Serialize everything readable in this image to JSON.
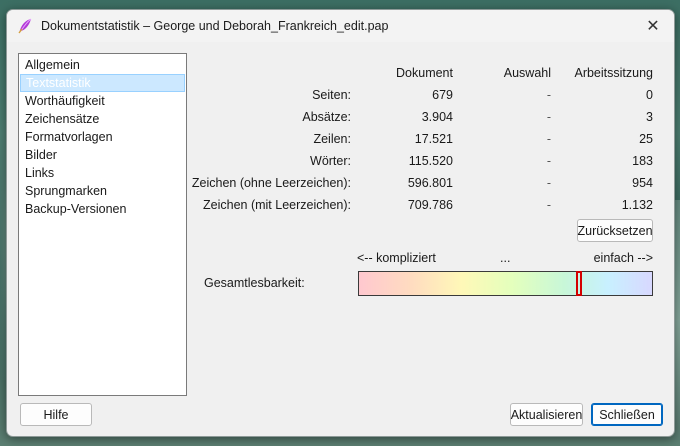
{
  "window": {
    "title": "Dokumentstatistik – George und Deborah_Frankreich_edit.pap",
    "close_glyph": "✕"
  },
  "sidebar": {
    "items": [
      {
        "label": "Allgemein"
      },
      {
        "label": "Textstatistik"
      },
      {
        "label": "Worthäufigkeit"
      },
      {
        "label": "Zeichensätze"
      },
      {
        "label": "Formatvorlagen"
      },
      {
        "label": "Bilder"
      },
      {
        "label": "Links"
      },
      {
        "label": "Sprungmarken"
      },
      {
        "label": "Backup-Versionen"
      }
    ],
    "selected_index": 1
  },
  "stats": {
    "headers": {
      "document": "Dokument",
      "selection": "Auswahl",
      "session": "Arbeitssitzung"
    },
    "rows": [
      {
        "label": "Seiten:",
        "document": "679",
        "selection": "-",
        "session": "0"
      },
      {
        "label": "Absätze:",
        "document": "3.904",
        "selection": "-",
        "session": "3"
      },
      {
        "label": "Zeilen:",
        "document": "17.521",
        "selection": "-",
        "session": "25"
      },
      {
        "label": "Wörter:",
        "document": "115.520",
        "selection": "-",
        "session": "183"
      },
      {
        "label": "Zeichen (ohne Leerzeichen):",
        "document": "596.801",
        "selection": "-",
        "session": "954"
      },
      {
        "label": "Zeichen (mit Leerzeichen):",
        "document": "709.786",
        "selection": "-",
        "session": "1.132"
      }
    ]
  },
  "buttons": {
    "reset": "Zurücksetzen",
    "help": "Hilfe",
    "refresh": "Aktualisieren",
    "close": "Schließen"
  },
  "readability": {
    "label": "Gesamtlesbarkeit:",
    "scale_left": "<-- kompliziert",
    "scale_mid": "...",
    "scale_right": "einfach -->",
    "level_fraction": 0.755,
    "marker_color": "#d40000"
  },
  "colors": {
    "selection_bg": "#cce8ff",
    "accent": "#0067c0"
  }
}
